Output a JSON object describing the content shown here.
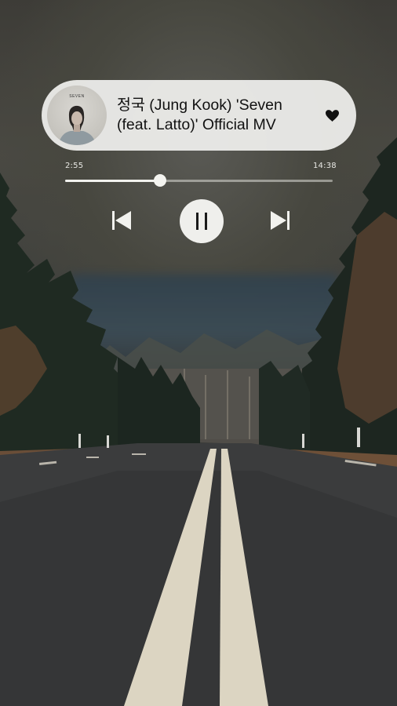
{
  "now_playing": {
    "title": "정국 (Jung Kook) 'Seven\n(feat. Latto)' Official MV",
    "album_art_text": "SEVEN",
    "liked": true,
    "heart_icon": "heart-icon"
  },
  "progress": {
    "elapsed": "2:55",
    "total": "14:38",
    "fraction": 0.355
  },
  "controls": {
    "previous_icon": "skip-previous-icon",
    "pause_icon": "pause-icon",
    "next_icon": "skip-next-icon"
  },
  "colors": {
    "card": "#eeeeec",
    "text": "#111111",
    "track": "#dcdcd7",
    "controls": "#f2f2ee"
  }
}
